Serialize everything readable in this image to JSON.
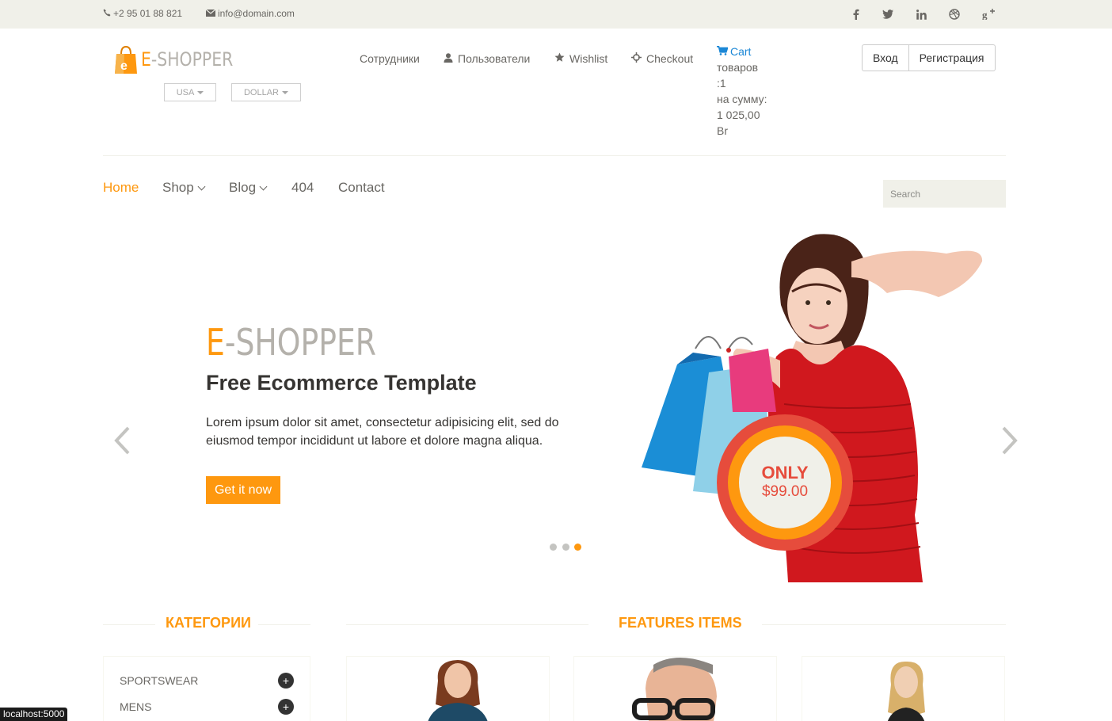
{
  "topbar": {
    "phone": "+2 95 01 88 821",
    "email": "info@domain.com",
    "social": [
      "f",
      "twitter-icon",
      "in",
      "dribbble-icon",
      "g+"
    ]
  },
  "header": {
    "logo_letter": "e",
    "logo_e": "E",
    "logo_rest": "-SHOPPER",
    "country": "USA",
    "currency": "DOLLAR",
    "nav": {
      "staff": "Сотрудники",
      "users": "Пользователи",
      "wishlist": "Wishlist",
      "checkout": "Checkout"
    },
    "cart": {
      "label": "Cart",
      "line1": "товаров",
      "line2": ":1",
      "line3": "на сумму:",
      "line4": "1 025,00",
      "line5": "Br"
    },
    "login": "Вход",
    "register": "Регистрация"
  },
  "mainnav": {
    "home": "Home",
    "shop": "Shop",
    "blog": "Blog",
    "p404": "404",
    "contact": "Contact",
    "search_placeholder": "Search"
  },
  "slider": {
    "brand_e": "E",
    "brand_rest": "-SHOPPER",
    "title": "Free Ecommerce Template",
    "text": "Lorem ipsum dolor sit amet, consectetur adipisicing elit, sed do eiusmod tempor incididunt ut labore et dolore magna aliqua.",
    "button": "Get it now",
    "badge_only": "ONLY",
    "badge_price": "$99.00",
    "active_slide": 3
  },
  "sections": {
    "categories_title": "КАТЕГОРИИ",
    "features_title": "FEATURES ITEMS",
    "categories": [
      "SPORTSWEAR",
      "MENS"
    ]
  },
  "status_url": "localhost:5000",
  "colors": {
    "accent": "#fe980f",
    "topbar_bg": "#f0f0e9",
    "cart_link": "#1b87d6",
    "badge_red": "#e64c3c"
  }
}
